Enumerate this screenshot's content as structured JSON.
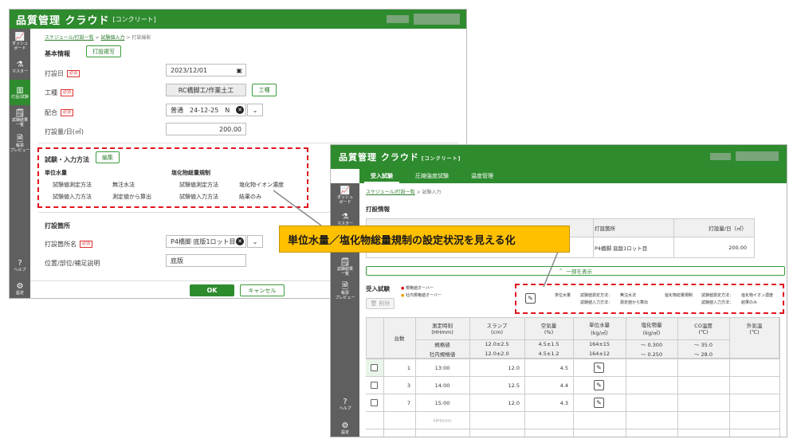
{
  "app": {
    "logo": "品質管理 クラウド",
    "edition": "[コンクリート]"
  },
  "win1": {
    "nav": [
      {
        "icon": "chart-icon",
        "glyph": "📈",
        "label": "ダッシュ\nボード"
      },
      {
        "icon": "flask-icon",
        "glyph": "⚗",
        "label": "マスター"
      },
      {
        "icon": "pour-icon",
        "glyph": "▥",
        "label": "打設/試験"
      },
      {
        "icon": "results-icon",
        "glyph": "🗒",
        "label": "試験結果\n一覧"
      },
      {
        "icon": "form-icon",
        "glyph": "🗎",
        "label": "帳票\nプレビュー"
      }
    ],
    "nav_bottom": [
      {
        "icon": "help-icon",
        "glyph": "?",
        "label": "ヘルプ"
      },
      {
        "icon": "gear-icon",
        "glyph": "⚙",
        "label": "設定"
      }
    ],
    "breadcrumb": {
      "a": "スケジュール/打設一覧",
      "b": "試験値入力",
      "c": "打設撮影"
    },
    "basic_info": "基本情報",
    "copy_button": "打設複写",
    "pour_date_label": "打設日",
    "required": "必須",
    "pour_date": "2023/12/01",
    "work_type_label": "工種",
    "work_type": "RC橋脚工/作業土工",
    "work_type_button": "工種",
    "mix_label": "配合",
    "mix": "普通　24-12-25　N",
    "volume_label": "打設量/日(㎥)",
    "volume": "200.00",
    "test_method_title": "試験・入力方法",
    "edit_button": "編集",
    "unit_water": "単位水量",
    "uw_measure": "試験値測定方法",
    "uw_measure_val": "無注水法",
    "uw_input": "試験値入力方法",
    "uw_input_val": "測定値から算出",
    "chloride": "塩化物総量規制",
    "cl_measure": "試験値測定方法",
    "cl_measure_val": "塩化物イオン濃度",
    "cl_input": "試験値入力方法",
    "cl_input_val": "結果のみ",
    "location_title": "打設箇所",
    "location_name_label": "打設箇所名",
    "location_name": "P4橋脚 底版1ロット目",
    "position_label": "位置/部位/補足説明",
    "position": "底版",
    "ok": "OK",
    "cancel": "キャンセル"
  },
  "win2": {
    "tabs": [
      "受入試験",
      "圧縮強度試験",
      "温度管理"
    ],
    "nav": [
      {
        "icon": "chart-icon",
        "glyph": "📈",
        "label": "ダッシュ\nボード"
      },
      {
        "icon": "flask-icon",
        "glyph": "⚗",
        "label": "マスター"
      },
      {
        "icon": "results-icon",
        "glyph": "🗒",
        "label": "試験結果\n一覧"
      },
      {
        "icon": "form-icon",
        "glyph": "🗎",
        "label": "帳票\nプレビュー"
      }
    ],
    "nav_bottom": [
      {
        "icon": "help-icon",
        "glyph": "?",
        "label": "ヘルプ"
      },
      {
        "icon": "gear-icon",
        "glyph": "⚙",
        "label": "設定"
      }
    ],
    "breadcrumb": {
      "a": "スケジュール/打設一覧",
      "b": "試験入力"
    },
    "pour_info": "打設情報",
    "pour_location_label": "打設箇所",
    "pour_volume_label": "打設量/日（㎥）",
    "pour_location": "P4橋脚 底版1ロット目",
    "pour_volume": "200.00",
    "show_part": "一部を表示",
    "accept_test": "受入試験",
    "legend_over": "規格値オーバー",
    "legend_inhouse": "社内規格値オーバー",
    "delete": "削除",
    "summary": {
      "uw": "単位水量",
      "uw_m_lbl": "試験値測定方法：",
      "uw_m": "無注水法",
      "uw_i_lbl": "試験値入力方法：",
      "uw_i": "測定値から算出",
      "cl": "塩化物総量規制",
      "cl_m_lbl": "試験値測定方法：",
      "cl_m": "塩化物イオン濃度",
      "cl_i_lbl": "試験値入力方法：",
      "cl_i": "結果のみ"
    },
    "table": {
      "col_count": "台数",
      "col_time": "測定時刻\n(HHmm)",
      "col_slump": "スランプ\n(cm)",
      "col_air": "空気量\n(%)",
      "col_water": "単位水量\n(kg/㎥)",
      "col_cl": "塩化物量\n(kg/㎥)",
      "col_co": "CO温度\n(℃)",
      "col_ext": "外気温\n(℃)",
      "spec_label": "規格値",
      "inhouse_label": "社内規格値",
      "spec": {
        "slump": "12.0±2.5",
        "air": "4.5±1.5",
        "water": "164±15",
        "cl": "〜 0.300",
        "co": "〜 35.0"
      },
      "inhouse": {
        "slump": "12.0±2.0",
        "air": "4.5±1.2",
        "water": "164±12",
        "cl": "〜 0.250",
        "co": "〜 28.0"
      },
      "rows": [
        {
          "count": "1",
          "time": "13:00",
          "slump": "12.0",
          "air": "4.5"
        },
        {
          "count": "3",
          "time": "14:00",
          "slump": "12.5",
          "air": "4.4"
        },
        {
          "count": "7",
          "time": "15:00",
          "slump": "12.0",
          "air": "4.3"
        }
      ],
      "placeholder_time": "HHmm"
    }
  },
  "callout": "単位水量／塩化物総量規制の設定状況を見える化",
  "colors": {
    "brand": "#2e8b2e",
    "alert": "#e0141e",
    "callout": "#ffc000"
  }
}
